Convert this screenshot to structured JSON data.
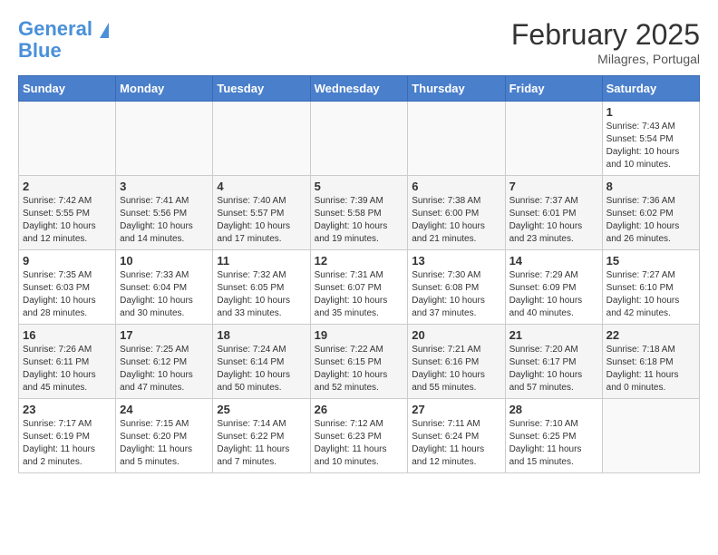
{
  "logo": {
    "line1": "General",
    "line2": "Blue"
  },
  "header": {
    "month": "February 2025",
    "location": "Milagres, Portugal"
  },
  "weekdays": [
    "Sunday",
    "Monday",
    "Tuesday",
    "Wednesday",
    "Thursday",
    "Friday",
    "Saturday"
  ],
  "weeks": [
    [
      {
        "day": "",
        "info": ""
      },
      {
        "day": "",
        "info": ""
      },
      {
        "day": "",
        "info": ""
      },
      {
        "day": "",
        "info": ""
      },
      {
        "day": "",
        "info": ""
      },
      {
        "day": "",
        "info": ""
      },
      {
        "day": "1",
        "info": "Sunrise: 7:43 AM\nSunset: 5:54 PM\nDaylight: 10 hours\nand 10 minutes."
      }
    ],
    [
      {
        "day": "2",
        "info": "Sunrise: 7:42 AM\nSunset: 5:55 PM\nDaylight: 10 hours\nand 12 minutes."
      },
      {
        "day": "3",
        "info": "Sunrise: 7:41 AM\nSunset: 5:56 PM\nDaylight: 10 hours\nand 14 minutes."
      },
      {
        "day": "4",
        "info": "Sunrise: 7:40 AM\nSunset: 5:57 PM\nDaylight: 10 hours\nand 17 minutes."
      },
      {
        "day": "5",
        "info": "Sunrise: 7:39 AM\nSunset: 5:58 PM\nDaylight: 10 hours\nand 19 minutes."
      },
      {
        "day": "6",
        "info": "Sunrise: 7:38 AM\nSunset: 6:00 PM\nDaylight: 10 hours\nand 21 minutes."
      },
      {
        "day": "7",
        "info": "Sunrise: 7:37 AM\nSunset: 6:01 PM\nDaylight: 10 hours\nand 23 minutes."
      },
      {
        "day": "8",
        "info": "Sunrise: 7:36 AM\nSunset: 6:02 PM\nDaylight: 10 hours\nand 26 minutes."
      }
    ],
    [
      {
        "day": "9",
        "info": "Sunrise: 7:35 AM\nSunset: 6:03 PM\nDaylight: 10 hours\nand 28 minutes."
      },
      {
        "day": "10",
        "info": "Sunrise: 7:33 AM\nSunset: 6:04 PM\nDaylight: 10 hours\nand 30 minutes."
      },
      {
        "day": "11",
        "info": "Sunrise: 7:32 AM\nSunset: 6:05 PM\nDaylight: 10 hours\nand 33 minutes."
      },
      {
        "day": "12",
        "info": "Sunrise: 7:31 AM\nSunset: 6:07 PM\nDaylight: 10 hours\nand 35 minutes."
      },
      {
        "day": "13",
        "info": "Sunrise: 7:30 AM\nSunset: 6:08 PM\nDaylight: 10 hours\nand 37 minutes."
      },
      {
        "day": "14",
        "info": "Sunrise: 7:29 AM\nSunset: 6:09 PM\nDaylight: 10 hours\nand 40 minutes."
      },
      {
        "day": "15",
        "info": "Sunrise: 7:27 AM\nSunset: 6:10 PM\nDaylight: 10 hours\nand 42 minutes."
      }
    ],
    [
      {
        "day": "16",
        "info": "Sunrise: 7:26 AM\nSunset: 6:11 PM\nDaylight: 10 hours\nand 45 minutes."
      },
      {
        "day": "17",
        "info": "Sunrise: 7:25 AM\nSunset: 6:12 PM\nDaylight: 10 hours\nand 47 minutes."
      },
      {
        "day": "18",
        "info": "Sunrise: 7:24 AM\nSunset: 6:14 PM\nDaylight: 10 hours\nand 50 minutes."
      },
      {
        "day": "19",
        "info": "Sunrise: 7:22 AM\nSunset: 6:15 PM\nDaylight: 10 hours\nand 52 minutes."
      },
      {
        "day": "20",
        "info": "Sunrise: 7:21 AM\nSunset: 6:16 PM\nDaylight: 10 hours\nand 55 minutes."
      },
      {
        "day": "21",
        "info": "Sunrise: 7:20 AM\nSunset: 6:17 PM\nDaylight: 10 hours\nand 57 minutes."
      },
      {
        "day": "22",
        "info": "Sunrise: 7:18 AM\nSunset: 6:18 PM\nDaylight: 11 hours\nand 0 minutes."
      }
    ],
    [
      {
        "day": "23",
        "info": "Sunrise: 7:17 AM\nSunset: 6:19 PM\nDaylight: 11 hours\nand 2 minutes."
      },
      {
        "day": "24",
        "info": "Sunrise: 7:15 AM\nSunset: 6:20 PM\nDaylight: 11 hours\nand 5 minutes."
      },
      {
        "day": "25",
        "info": "Sunrise: 7:14 AM\nSunset: 6:22 PM\nDaylight: 11 hours\nand 7 minutes."
      },
      {
        "day": "26",
        "info": "Sunrise: 7:12 AM\nSunset: 6:23 PM\nDaylight: 11 hours\nand 10 minutes."
      },
      {
        "day": "27",
        "info": "Sunrise: 7:11 AM\nSunset: 6:24 PM\nDaylight: 11 hours\nand 12 minutes."
      },
      {
        "day": "28",
        "info": "Sunrise: 7:10 AM\nSunset: 6:25 PM\nDaylight: 11 hours\nand 15 minutes."
      },
      {
        "day": "",
        "info": ""
      }
    ]
  ]
}
